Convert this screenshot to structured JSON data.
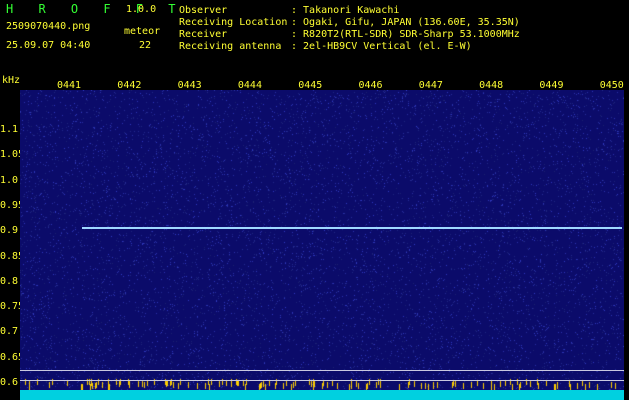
{
  "header": {
    "app_name": "H R O F F T",
    "version": "1.0.0",
    "filename": "2509070440.png",
    "datetime": "25.09.07 04:40",
    "meteor_label": "meteor",
    "meteor_count": "22",
    "fields": [
      {
        "label": "Observer",
        "value": ": Takanori Kawachi"
      },
      {
        "label": "Receiving Location",
        "value": ": Ogaki, Gifu, JAPAN (136.60E, 35.35N)"
      },
      {
        "label": "Receiver",
        "value": ": R820T2(RTL-SDR) SDR-Sharp 53.1000MHz"
      },
      {
        "label": "Receiving antenna",
        "value": ": 2el-HB9CV Vertical (el. E-W)"
      }
    ]
  },
  "plot": {
    "unit_label": "kHz",
    "time_ticks": [
      "0441",
      "0442",
      "0443",
      "0444",
      "0445",
      "0446",
      "0447",
      "0448",
      "0449",
      "0450"
    ],
    "freq_ticks": [
      "1.1",
      "1.05",
      "1.0",
      "0.95",
      "0.9",
      "0.85",
      "0.8",
      "0.75",
      "0.7",
      "0.65",
      "0.6"
    ],
    "colors": {
      "background": "#0b0b6a",
      "signal": "#9fd8ff",
      "bottom_band": "#00d0e0",
      "text": "#ffff33",
      "header_text": "#33ff33"
    }
  }
}
